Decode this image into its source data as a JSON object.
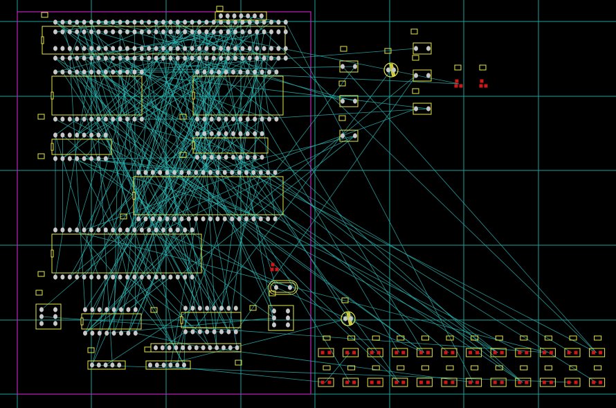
{
  "view": {
    "background": "#000000",
    "grid_color": "#1aa39a",
    "board_outline_color": "#c020c0",
    "silkscreen_color": "#e8e84a",
    "pad_color": "#c8c8c8",
    "smd_pad_color": "#d01818",
    "ratsnest_color": "#2bb3b0"
  }
}
